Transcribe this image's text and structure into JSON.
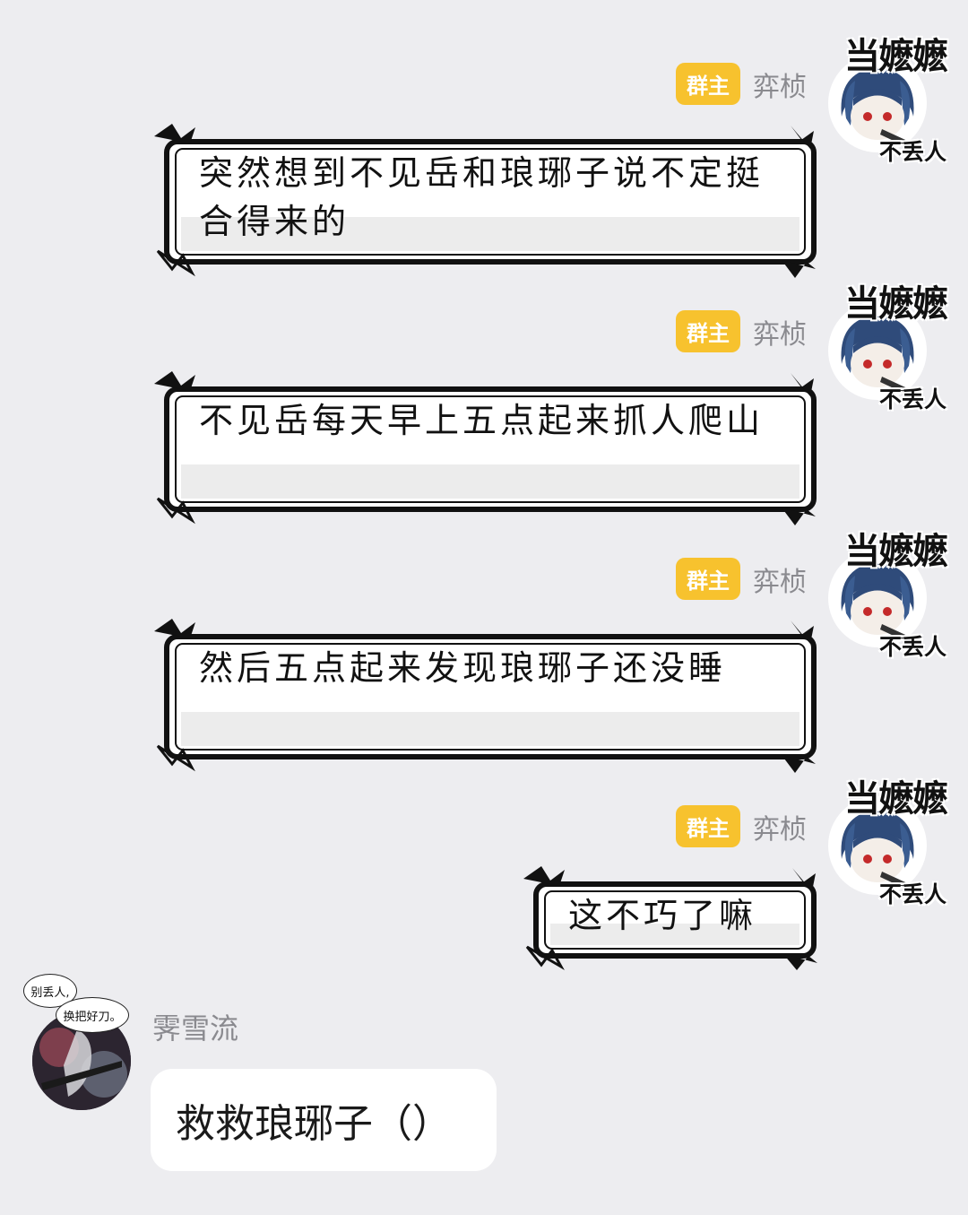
{
  "frame": {
    "title": "当嬷嬷",
    "caption": "不丢人"
  },
  "badge": "群主",
  "sender": "弈桢",
  "messages": [
    {
      "text": "突然想到不见岳和琅琊子说不定挺合得来的"
    },
    {
      "text": "不见岳每天早上五点起来抓人爬山"
    },
    {
      "text": "然后五点起来发现琅琊子还没睡"
    },
    {
      "text": "这不巧了嘛"
    }
  ],
  "other": {
    "name": "霁雪流",
    "speech_1": "别丢人,",
    "speech_2": "换把好刀。",
    "message": "救救琅琊子（）"
  }
}
